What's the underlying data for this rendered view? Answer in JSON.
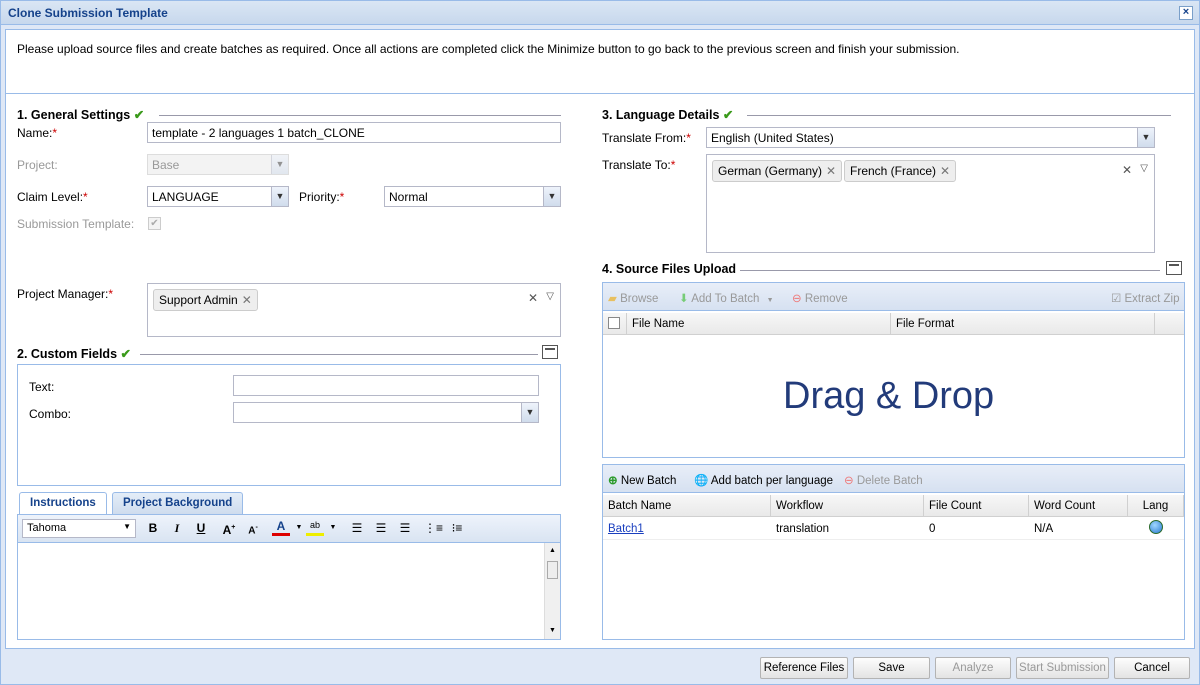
{
  "window": {
    "title": "Clone Submission Template",
    "close": "×"
  },
  "info_text": "Please upload source files and create batches as required. Once all actions are completed click the Minimize button to go back to the previous screen and finish your submission.",
  "general": {
    "heading": "1. General Settings",
    "name_label": "Name:",
    "name_value": "template - 2 languages 1 batch_CLONE",
    "project_label": "Project:",
    "project_value": "Base",
    "claim_label": "Claim Level:",
    "claim_value": "LANGUAGE",
    "priority_label": "Priority:",
    "priority_value": "Normal",
    "template_label": "Submission Template:",
    "pm_label": "Project Manager:",
    "pm_tag": "Support Admin"
  },
  "custom": {
    "heading": "2. Custom Fields",
    "text_label": "Text:",
    "combo_label": "Combo:"
  },
  "tabs": {
    "instructions": "Instructions",
    "background": "Project Background"
  },
  "editor": {
    "font": "Tahoma"
  },
  "language": {
    "heading": "3. Language Details",
    "from_label": "Translate From:",
    "from_value": "English (United States)",
    "to_label": "Translate To:",
    "to_tags": [
      "German (Germany)",
      "French (France)"
    ]
  },
  "upload": {
    "heading": "4. Source Files Upload",
    "browse": "Browse",
    "add_to_batch": "Add To Batch",
    "remove": "Remove",
    "extract_zip": "Extract Zip",
    "col_file_name": "File Name",
    "col_file_format": "File Format",
    "drag_drop": "Drag & Drop"
  },
  "batch": {
    "new_batch": "New Batch",
    "add_per_language": "Add batch per language",
    "delete_batch": "Delete Batch",
    "columns": [
      "Batch Name",
      "Workflow",
      "File Count",
      "Word Count",
      "Lang"
    ],
    "rows": [
      {
        "name": "Batch1",
        "workflow": "translation",
        "file_count": "0",
        "word_count": "N/A"
      }
    ]
  },
  "footer": {
    "reference": "Reference Files",
    "save": "Save",
    "analyze": "Analyze",
    "start": "Start Submission",
    "cancel": "Cancel"
  },
  "colors": {
    "accent": "#15428b",
    "border": "#99bbe8",
    "required": "#cc0000",
    "ok": "#3a9a1a"
  }
}
